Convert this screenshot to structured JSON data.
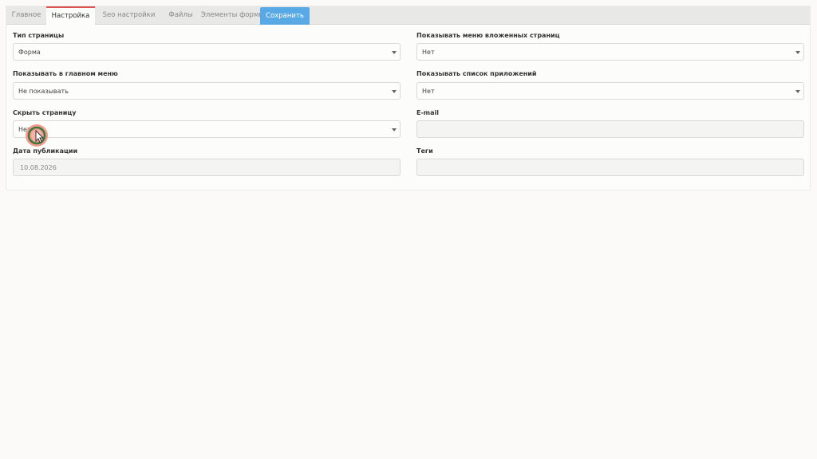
{
  "tabs": [
    {
      "label": "Главное"
    },
    {
      "label": "Настройка"
    },
    {
      "label": "Seo настройки"
    },
    {
      "label": "Файлы"
    },
    {
      "label": "Элементы формы"
    }
  ],
  "save_label": "Сохранить",
  "fields": {
    "page_type": {
      "label": "Тип страницы",
      "value": "Форма"
    },
    "show_nested_menu": {
      "label": "Показывать меню вложенных страниц",
      "value": "Нет"
    },
    "show_main_menu": {
      "label": "Показывать в главном меню",
      "value": "Не показывать"
    },
    "show_app_list": {
      "label": "Показывать список приложений",
      "value": "Нет"
    },
    "hide_page": {
      "label": "Скрыть страницу",
      "value": "Нет"
    },
    "email": {
      "label": "E-mail",
      "value": ""
    },
    "pub_date": {
      "label": "Дата публикации",
      "value": "10.08.2026"
    },
    "tags": {
      "label": "Теги",
      "value": ""
    }
  },
  "colors": {
    "accent": "#d9534f",
    "save_button": "#58a9e6",
    "cursor_ring": "#f08a7a"
  }
}
